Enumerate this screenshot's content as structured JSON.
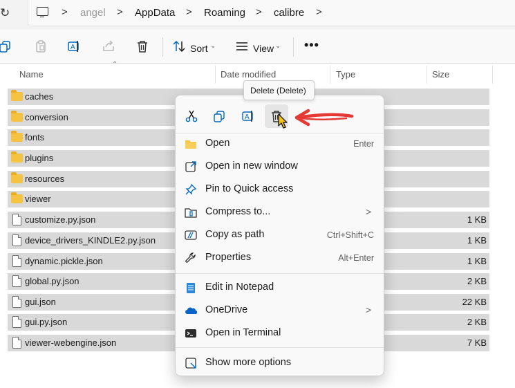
{
  "address_bar": {
    "refresh_icon": "refresh-icon",
    "crumbs": [
      "angel",
      "AppData",
      "Roaming",
      "calibre"
    ],
    "separator": ">"
  },
  "toolbar": {
    "sort_label": "Sort",
    "view_label": "View",
    "more_label": "•••",
    "icons": [
      "copy-icon",
      "paste-icon",
      "rename-icon",
      "share-icon",
      "delete-icon",
      "sort-icon",
      "view-icon"
    ]
  },
  "columns": {
    "name": "Name",
    "date_modified": "Date modified",
    "type": "Type",
    "size": "Size"
  },
  "files": [
    {
      "name": "caches",
      "kind": "folder",
      "size": ""
    },
    {
      "name": "conversion",
      "kind": "folder",
      "size": ""
    },
    {
      "name": "fonts",
      "kind": "folder",
      "size": ""
    },
    {
      "name": "plugins",
      "kind": "folder",
      "size": ""
    },
    {
      "name": "resources",
      "kind": "folder",
      "size": ""
    },
    {
      "name": "viewer",
      "kind": "folder",
      "size": ""
    },
    {
      "name": "customize.py.json",
      "kind": "file",
      "size": "1 KB"
    },
    {
      "name": "device_drivers_KINDLE2.py.json",
      "kind": "file",
      "size": "1 KB"
    },
    {
      "name": "dynamic.pickle.json",
      "kind": "file",
      "size": "1 KB"
    },
    {
      "name": "global.py.json",
      "kind": "file",
      "size": "2 KB"
    },
    {
      "name": "gui.json",
      "kind": "file",
      "size": "22 KB"
    },
    {
      "name": "gui.py.json",
      "kind": "file",
      "size": "2 KB"
    },
    {
      "name": "viewer-webengine.json",
      "kind": "file",
      "size": "7 KB"
    }
  ],
  "tooltip": "Delete (Delete)",
  "context_menu": {
    "quick_actions": [
      "cut-icon",
      "copy-icon",
      "rename-icon",
      "delete-icon"
    ],
    "items": [
      {
        "label": "Open",
        "shortcut": "Enter",
        "icon": "folder-icon"
      },
      {
        "label": "Open in new window",
        "shortcut": "",
        "icon": "new-window-icon"
      },
      {
        "label": "Pin to Quick access",
        "shortcut": "",
        "icon": "pin-icon"
      },
      {
        "label": "Compress to...",
        "shortcut": "",
        "icon": "compress-icon",
        "submenu": true
      },
      {
        "label": "Copy as path",
        "shortcut": "Ctrl+Shift+C",
        "icon": "copy-path-icon"
      },
      {
        "label": "Properties",
        "shortcut": "Alt+Enter",
        "icon": "wrench-icon"
      },
      {
        "label": "Edit in Notepad",
        "shortcut": "",
        "icon": "notepad-icon"
      },
      {
        "label": "OneDrive",
        "shortcut": "",
        "icon": "onedrive-icon",
        "submenu": true
      },
      {
        "label": "Open in Terminal",
        "shortcut": "",
        "icon": "terminal-icon"
      },
      {
        "label": "Show more options",
        "shortcut": "",
        "icon": "more-options-icon"
      }
    ],
    "submenu_arrow": ">"
  },
  "colors": {
    "selection": "#d9d9d9",
    "accent_blue": "#0067c0",
    "annotation_red": "#e53935",
    "folder_yellow": "#f5c242"
  }
}
